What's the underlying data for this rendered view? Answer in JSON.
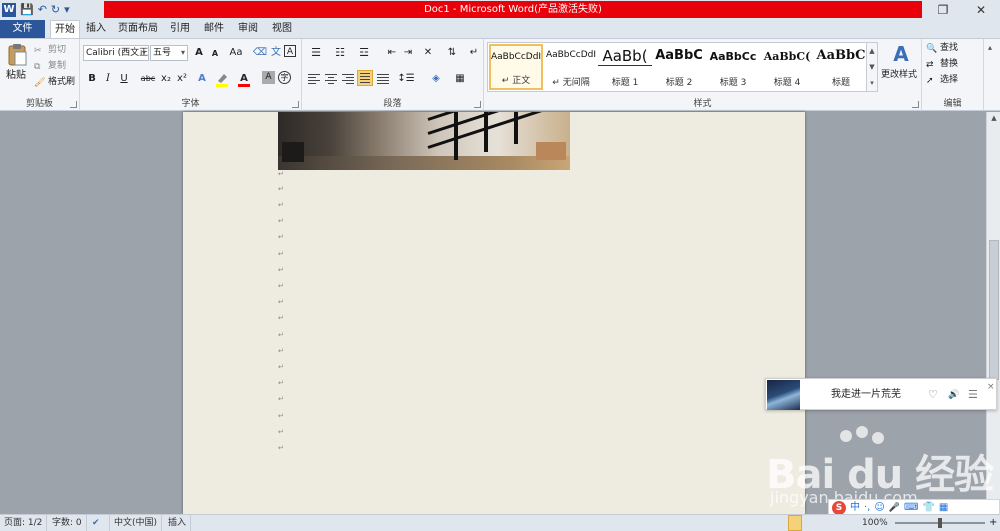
{
  "window": {
    "title": "Doc1 - Microsoft Word(产品激活失败)",
    "logo": "W",
    "restore_icon": "❐",
    "close_icon": "✕"
  },
  "quick_access": {
    "save_icon": "💾",
    "undo_icon": "↶",
    "redo_icon": "↻",
    "customize_icon": "▾"
  },
  "tabs": [
    {
      "label": "文件"
    },
    {
      "label": "开始"
    },
    {
      "label": "插入"
    },
    {
      "label": "页面布局"
    },
    {
      "label": "引用"
    },
    {
      "label": "邮件"
    },
    {
      "label": "审阅"
    },
    {
      "label": "视图"
    }
  ],
  "clipboard": {
    "group_label": "剪贴板",
    "paste_label": "粘贴",
    "cut_label": "剪切",
    "copy_label": "复制",
    "format_painter_label": "格式刷"
  },
  "font": {
    "group_label": "字体",
    "font_name": "Calibri (西文正文)",
    "font_size": "五号",
    "grow_label": "A",
    "shrink_label": "A",
    "change_case_label": "Aa",
    "bold": "B",
    "italic": "I",
    "underline": "U",
    "strikethrough": "abc",
    "subscript": "x₂",
    "superscript": "x²",
    "highlight_color": "#ffff00",
    "font_color": "#ff0000"
  },
  "paragraph": {
    "group_label": "段落"
  },
  "styles": {
    "group_label": "样式",
    "items": [
      {
        "sample": "AaBbCcDdI",
        "name": "↵ 正文"
      },
      {
        "sample": "AaBbCcDdI",
        "name": "↵ 无间隔"
      },
      {
        "sample": "AaBb(",
        "name": "标题 1"
      },
      {
        "sample": "AaBbC",
        "name": "标题 2"
      },
      {
        "sample": "AaBbCc",
        "name": "标题 3"
      },
      {
        "sample": "AaBbC(",
        "name": "标题 4"
      },
      {
        "sample": "AaBbC",
        "name": "标题"
      }
    ],
    "change_styles_label": "更改样式"
  },
  "editing": {
    "group_label": "编辑",
    "find_label": "查找",
    "replace_label": "替换",
    "select_label": "选择"
  },
  "document": {
    "paragraph_mark": "↵"
  },
  "music_popup": {
    "song_title": "我走进一片荒芜",
    "heart_icon": "♡",
    "volume_icon": "🔊",
    "list_icon": "☰",
    "close_icon": "×"
  },
  "watermark": {
    "logo_text": "Bai  du 经验",
    "url": "jingyan.baidu.com"
  },
  "ime": {
    "logo": "S",
    "mode": "中",
    "punct": "·,",
    "emoji": "☺",
    "mic": "🎤"
  },
  "status": {
    "page": "页面: 1/2",
    "words": "字数: 0",
    "language": "中文(中国)",
    "mode": "插入",
    "zoom": "100%"
  }
}
